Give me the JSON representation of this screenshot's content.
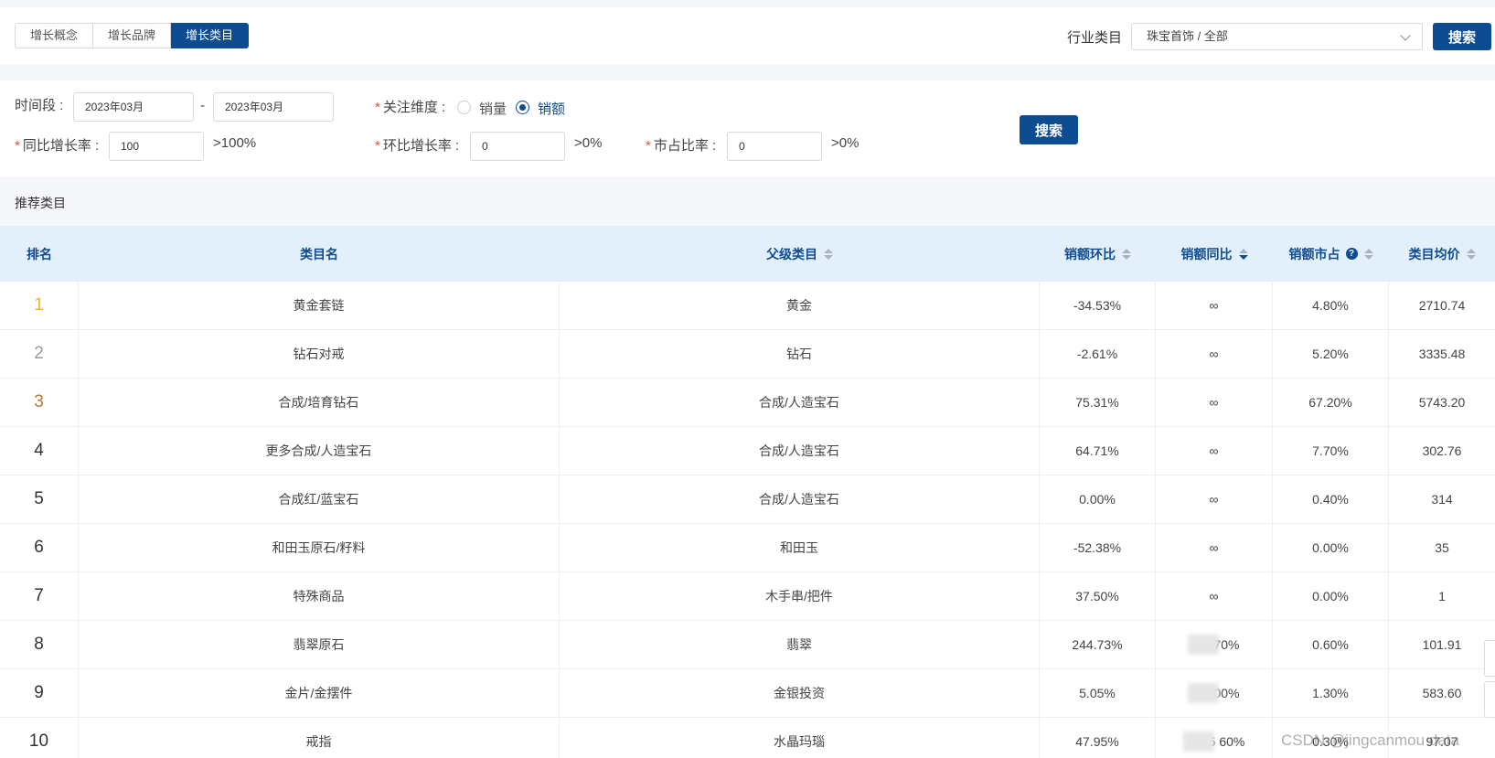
{
  "tabs": [
    "增长概念",
    "增长品牌",
    "增长类目"
  ],
  "active_tab": 2,
  "industry": {
    "label": "行业类目",
    "value": "珠宝首饰 / 全部",
    "search_label": "搜索"
  },
  "filters": {
    "period_label": "时间段 :",
    "start": "2023年03月",
    "separator": "-",
    "end": "2023年03月",
    "dimension_label": "关注维度 :",
    "dim_opt_volume": "销量",
    "dim_opt_amount": "销额",
    "yoy_label": "同比增长率 :",
    "yoy_value": "100",
    "yoy_hint": ">100%",
    "mom_label": "环比增长率 :",
    "mom_value": "0",
    "mom_hint": ">0%",
    "share_label": "市占比率 :",
    "share_value": "0",
    "share_hint": ">0%",
    "required_mark": "*",
    "search_label": "搜索"
  },
  "section_title": "推荐类目",
  "table": {
    "headers": {
      "rank": "排名",
      "name": "类目名",
      "parent": "父级类目",
      "mom": "销额环比",
      "yoy": "销额同比",
      "share": "销额市占",
      "avg": "类目均价",
      "help": "?"
    },
    "rows": [
      {
        "rank": "1",
        "name": "黄金套链",
        "parent": "黄金",
        "mom": "-34.53%",
        "yoy": "∞",
        "share": "4.80%",
        "avg": "2710.74"
      },
      {
        "rank": "2",
        "name": "钻石对戒",
        "parent": "钻石",
        "mom": "-2.61%",
        "yoy": "∞",
        "share": "5.20%",
        "avg": "3335.48"
      },
      {
        "rank": "3",
        "name": "合成/培育钻石",
        "parent": "合成/人造宝石",
        "mom": "75.31%",
        "yoy": "∞",
        "share": "67.20%",
        "avg": "5743.20"
      },
      {
        "rank": "4",
        "name": "更多合成/人造宝石",
        "parent": "合成/人造宝石",
        "mom": "64.71%",
        "yoy": "∞",
        "share": "7.70%",
        "avg": "302.76"
      },
      {
        "rank": "5",
        "name": "合成红/蓝宝石",
        "parent": "合成/人造宝石",
        "mom": "0.00%",
        "yoy": "∞",
        "share": "0.40%",
        "avg": "314"
      },
      {
        "rank": "6",
        "name": "和田玉原石/籽料",
        "parent": "和田玉",
        "mom": "-52.38%",
        "yoy": "∞",
        "share": "0.00%",
        "avg": "35"
      },
      {
        "rank": "7",
        "name": "特殊商品",
        "parent": "木手串/把件",
        "mom": "37.50%",
        "yoy": "∞",
        "share": "0.00%",
        "avg": "1"
      },
      {
        "rank": "8",
        "name": "翡翠原石",
        "parent": "翡翠",
        "mom": "244.73%",
        "yoy": "70%",
        "share": "0.60%",
        "avg": "101.91"
      },
      {
        "rank": "9",
        "name": "金片/金摆件",
        "parent": "金银投资",
        "mom": "5.05%",
        "yoy": "00%",
        "share": "1.30%",
        "avg": "583.60"
      },
      {
        "rank": "10",
        "name": "戒指",
        "parent": "水晶玛瑙",
        "mom": "47.95%",
        "yoy": "5 60%",
        "share": "0.30%",
        "avg": "97.07"
      }
    ]
  },
  "watermark": "CSDN @jingcanmou data"
}
